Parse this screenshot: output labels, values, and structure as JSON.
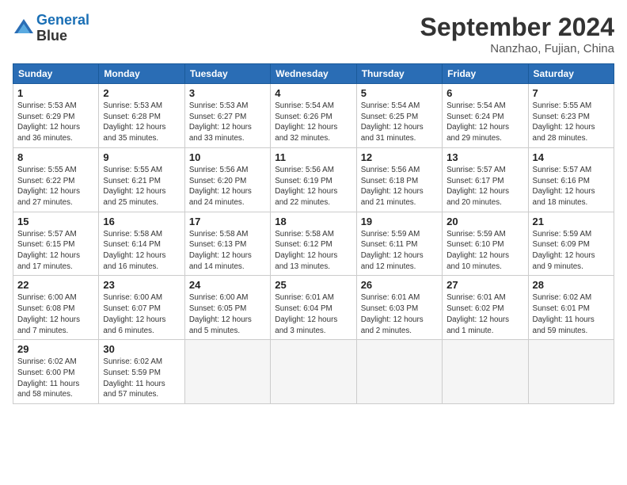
{
  "header": {
    "logo_line1": "General",
    "logo_line2": "Blue",
    "month": "September 2024",
    "location": "Nanzhao, Fujian, China"
  },
  "weekdays": [
    "Sunday",
    "Monday",
    "Tuesday",
    "Wednesday",
    "Thursday",
    "Friday",
    "Saturday"
  ],
  "weeks": [
    [
      {
        "day": "1",
        "info": "Sunrise: 5:53 AM\nSunset: 6:29 PM\nDaylight: 12 hours\nand 36 minutes."
      },
      {
        "day": "2",
        "info": "Sunrise: 5:53 AM\nSunset: 6:28 PM\nDaylight: 12 hours\nand 35 minutes."
      },
      {
        "day": "3",
        "info": "Sunrise: 5:53 AM\nSunset: 6:27 PM\nDaylight: 12 hours\nand 33 minutes."
      },
      {
        "day": "4",
        "info": "Sunrise: 5:54 AM\nSunset: 6:26 PM\nDaylight: 12 hours\nand 32 minutes."
      },
      {
        "day": "5",
        "info": "Sunrise: 5:54 AM\nSunset: 6:25 PM\nDaylight: 12 hours\nand 31 minutes."
      },
      {
        "day": "6",
        "info": "Sunrise: 5:54 AM\nSunset: 6:24 PM\nDaylight: 12 hours\nand 29 minutes."
      },
      {
        "day": "7",
        "info": "Sunrise: 5:55 AM\nSunset: 6:23 PM\nDaylight: 12 hours\nand 28 minutes."
      }
    ],
    [
      {
        "day": "8",
        "info": "Sunrise: 5:55 AM\nSunset: 6:22 PM\nDaylight: 12 hours\nand 27 minutes."
      },
      {
        "day": "9",
        "info": "Sunrise: 5:55 AM\nSunset: 6:21 PM\nDaylight: 12 hours\nand 25 minutes."
      },
      {
        "day": "10",
        "info": "Sunrise: 5:56 AM\nSunset: 6:20 PM\nDaylight: 12 hours\nand 24 minutes."
      },
      {
        "day": "11",
        "info": "Sunrise: 5:56 AM\nSunset: 6:19 PM\nDaylight: 12 hours\nand 22 minutes."
      },
      {
        "day": "12",
        "info": "Sunrise: 5:56 AM\nSunset: 6:18 PM\nDaylight: 12 hours\nand 21 minutes."
      },
      {
        "day": "13",
        "info": "Sunrise: 5:57 AM\nSunset: 6:17 PM\nDaylight: 12 hours\nand 20 minutes."
      },
      {
        "day": "14",
        "info": "Sunrise: 5:57 AM\nSunset: 6:16 PM\nDaylight: 12 hours\nand 18 minutes."
      }
    ],
    [
      {
        "day": "15",
        "info": "Sunrise: 5:57 AM\nSunset: 6:15 PM\nDaylight: 12 hours\nand 17 minutes."
      },
      {
        "day": "16",
        "info": "Sunrise: 5:58 AM\nSunset: 6:14 PM\nDaylight: 12 hours\nand 16 minutes."
      },
      {
        "day": "17",
        "info": "Sunrise: 5:58 AM\nSunset: 6:13 PM\nDaylight: 12 hours\nand 14 minutes."
      },
      {
        "day": "18",
        "info": "Sunrise: 5:58 AM\nSunset: 6:12 PM\nDaylight: 12 hours\nand 13 minutes."
      },
      {
        "day": "19",
        "info": "Sunrise: 5:59 AM\nSunset: 6:11 PM\nDaylight: 12 hours\nand 12 minutes."
      },
      {
        "day": "20",
        "info": "Sunrise: 5:59 AM\nSunset: 6:10 PM\nDaylight: 12 hours\nand 10 minutes."
      },
      {
        "day": "21",
        "info": "Sunrise: 5:59 AM\nSunset: 6:09 PM\nDaylight: 12 hours\nand 9 minutes."
      }
    ],
    [
      {
        "day": "22",
        "info": "Sunrise: 6:00 AM\nSunset: 6:08 PM\nDaylight: 12 hours\nand 7 minutes."
      },
      {
        "day": "23",
        "info": "Sunrise: 6:00 AM\nSunset: 6:07 PM\nDaylight: 12 hours\nand 6 minutes."
      },
      {
        "day": "24",
        "info": "Sunrise: 6:00 AM\nSunset: 6:05 PM\nDaylight: 12 hours\nand 5 minutes."
      },
      {
        "day": "25",
        "info": "Sunrise: 6:01 AM\nSunset: 6:04 PM\nDaylight: 12 hours\nand 3 minutes."
      },
      {
        "day": "26",
        "info": "Sunrise: 6:01 AM\nSunset: 6:03 PM\nDaylight: 12 hours\nand 2 minutes."
      },
      {
        "day": "27",
        "info": "Sunrise: 6:01 AM\nSunset: 6:02 PM\nDaylight: 12 hours\nand 1 minute."
      },
      {
        "day": "28",
        "info": "Sunrise: 6:02 AM\nSunset: 6:01 PM\nDaylight: 11 hours\nand 59 minutes."
      }
    ],
    [
      {
        "day": "29",
        "info": "Sunrise: 6:02 AM\nSunset: 6:00 PM\nDaylight: 11 hours\nand 58 minutes."
      },
      {
        "day": "30",
        "info": "Sunrise: 6:02 AM\nSunset: 5:59 PM\nDaylight: 11 hours\nand 57 minutes."
      },
      {
        "day": "",
        "info": ""
      },
      {
        "day": "",
        "info": ""
      },
      {
        "day": "",
        "info": ""
      },
      {
        "day": "",
        "info": ""
      },
      {
        "day": "",
        "info": ""
      }
    ]
  ]
}
